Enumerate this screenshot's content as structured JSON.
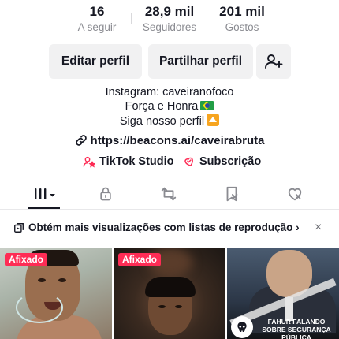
{
  "stats": [
    {
      "value": "16",
      "label": "A seguir"
    },
    {
      "value": "28,9 mil",
      "label": "Seguidores"
    },
    {
      "value": "201 mil",
      "label": "Gostos"
    }
  ],
  "actions": {
    "edit_label": "Editar perfil",
    "share_label": "Partilhar perfil",
    "add_friend_icon": "add-user-icon"
  },
  "bio": {
    "line1": "Instagram: caveiranofoco",
    "line2": "Força e Honra",
    "line3": "Siga nosso perfil"
  },
  "link": {
    "url": "https://beacons.ai/caveirabruta"
  },
  "quick_links": {
    "studio": "TikTok Studio",
    "subscription": "Subscrição"
  },
  "tabs": [
    {
      "icon": "grid-videos-icon",
      "selected": true
    },
    {
      "icon": "lock-icon",
      "selected": false
    },
    {
      "icon": "repost-icon",
      "selected": false
    },
    {
      "icon": "bookmark-icon",
      "selected": false
    },
    {
      "icon": "liked-heart-icon",
      "selected": false
    }
  ],
  "banner": {
    "text": "Obtém mais visualizações com listas de reprodução",
    "close": "×"
  },
  "videos": [
    {
      "pinned_label": "Afixado"
    },
    {
      "pinned_label": "Afixado"
    },
    {
      "caption": "FAHUR FALANDO SOBRE SEGURANÇA PÚBLICA"
    }
  ],
  "colors": {
    "accent": "#fe2c55",
    "text": "#161823",
    "muted": "#8a8b91",
    "button_bg": "#f1f1f2"
  }
}
